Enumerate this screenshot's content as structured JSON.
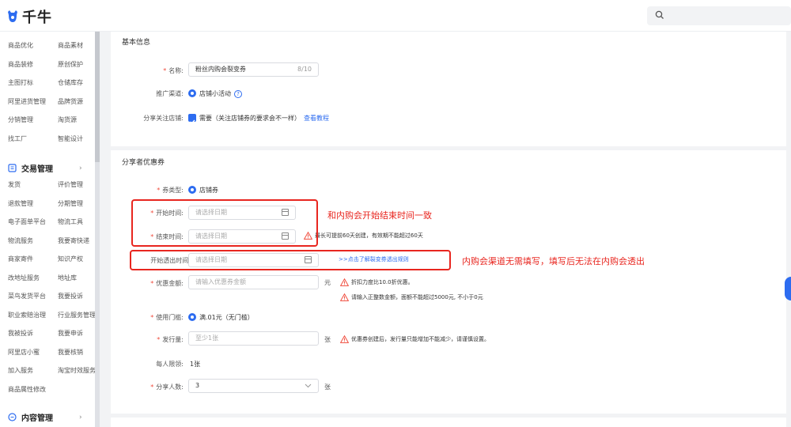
{
  "app": {
    "logo_text": "千牛",
    "search_placeholder": ""
  },
  "sidebar": {
    "col1": [
      "商品优化",
      "商品装修",
      "主图打标",
      "阿里进货管理",
      "分销管理",
      "找工厂"
    ],
    "col2": [
      "商品素材",
      "原创保护",
      "仓储库存",
      "品牌货源",
      "淘货源",
      "智能设计"
    ],
    "section_trade": "交易管理",
    "trade_col1": [
      "发货",
      "退款管理",
      "电子面单平台",
      "物流服务",
      "商家寄件",
      "改地址服务",
      "菜鸟发货平台",
      "职业索赔治理",
      "我被投诉",
      "阿里店小蜜",
      "加入服务",
      "商品属性修改"
    ],
    "trade_col2": [
      "评价管理",
      "分期管理",
      "物流工具",
      "我要寄快递",
      "知识产权",
      "地址库",
      "我要投诉",
      "行业服务管理",
      "我要申诉",
      "我要核销",
      "淘宝时效服务"
    ],
    "section_content": "内容管理"
  },
  "basic": {
    "title": "基本信息",
    "name_label": "名称:",
    "name_value": "粉丝内购会裂变券",
    "name_count": "8/10",
    "channel_label": "推广渠道:",
    "channel_value": "店铺小活动",
    "share_label": "分享关注店铺:",
    "share_value": "需要（关注店铺券的要求会不一样）",
    "share_link": "查看教程"
  },
  "coupon": {
    "title": "分享者优惠券",
    "type_label": "券类型:",
    "type_value": "店铺券",
    "start_label": "开始时间:",
    "start_placeholder": "请选择日期",
    "end_label": "结束时间:",
    "end_placeholder": "请选择日期",
    "end_warn": "最长可提前60天创建，有效期不能超过60天",
    "leak_label": "开始透出时间:",
    "leak_placeholder": "请选择日期",
    "leak_link": ">>点击了解裂变券透出规则",
    "amount_label": "优惠金额:",
    "amount_placeholder": "请输入优惠券金额",
    "amount_unit": "元",
    "amount_warn1": "折扣力度比10.0折优惠。",
    "amount_warn2": "请输入正整数金额，面额不能超过5000元, 不小于0元",
    "threshold_label": "使用门槛:",
    "threshold_value": "满.01元（无门槛）",
    "issue_label": "发行量:",
    "issue_placeholder": "至少1张",
    "issue_unit": "张",
    "issue_warn": "优惠券创建后，发行量只能增加不能减少，请谨慎设置。",
    "limit_label": "每人限领:",
    "limit_value": "1张",
    "sharers_label": "分享人数:",
    "sharers_value": "3",
    "sharers_unit": "张"
  },
  "annotations": {
    "note1": "和内购会开始结束时间一致",
    "note2": "内购会渠道无需填写，填写后无法在内购会透出"
  },
  "colors": {
    "accent": "#2d6cf0",
    "annotation": "#e8261f",
    "warning": "#f04b3c"
  }
}
